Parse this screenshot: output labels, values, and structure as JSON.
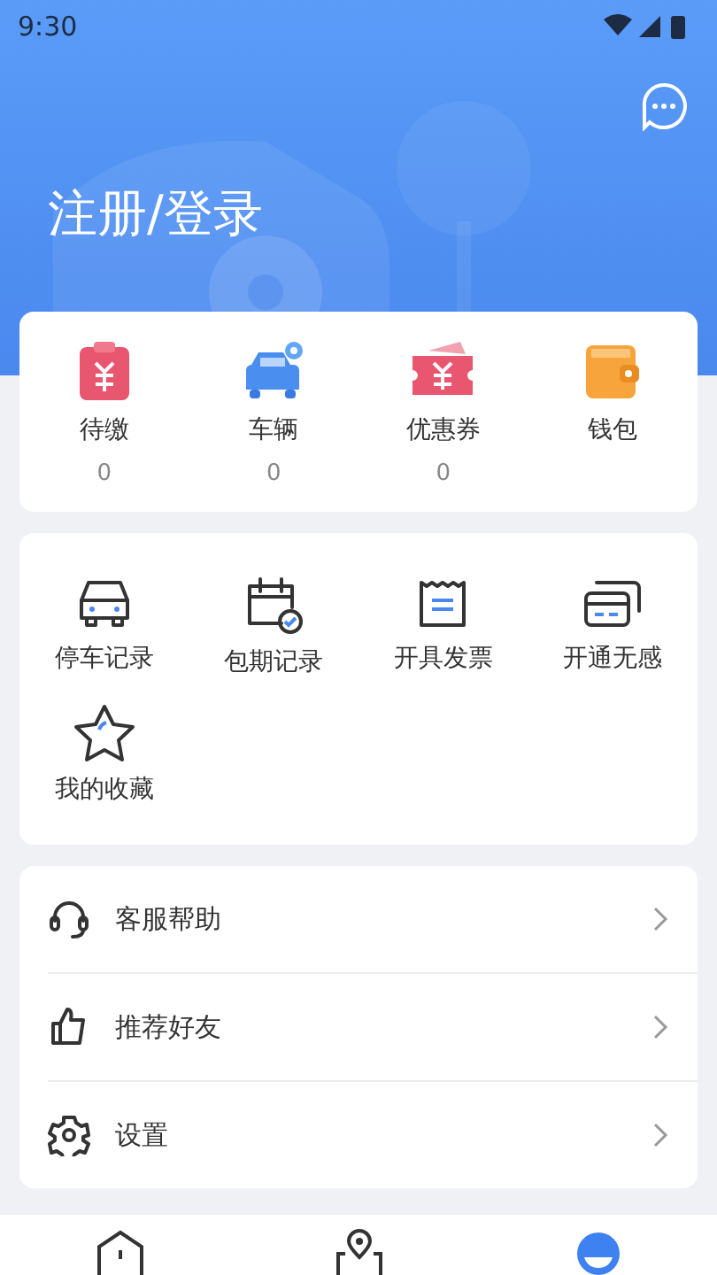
{
  "status_bar": {
    "time": "9:30"
  },
  "header": {
    "title": "注册/登录"
  },
  "assets": [
    {
      "kind": "bill",
      "label": "待缴",
      "count": "0"
    },
    {
      "kind": "car",
      "label": "车辆",
      "count": "0"
    },
    {
      "kind": "coupon",
      "label": "优惠券",
      "count": "0"
    },
    {
      "kind": "wallet",
      "label": "钱包"
    }
  ],
  "services": [
    {
      "kind": "car",
      "label": "停车记录"
    },
    {
      "kind": "calendar",
      "label": "包期记录"
    },
    {
      "kind": "receipt",
      "label": "开具发票"
    },
    {
      "kind": "cards",
      "label": "开通无感"
    },
    {
      "kind": "star",
      "label": "我的收藏"
    }
  ],
  "menu": [
    {
      "kind": "headset",
      "label": "客服帮助"
    },
    {
      "kind": "thumb",
      "label": "推荐好友"
    },
    {
      "kind": "gear",
      "label": "设置"
    }
  ],
  "bottom_nav": [
    {
      "kind": "home",
      "selected": false
    },
    {
      "kind": "map",
      "selected": false
    },
    {
      "kind": "profile",
      "selected": true
    }
  ]
}
